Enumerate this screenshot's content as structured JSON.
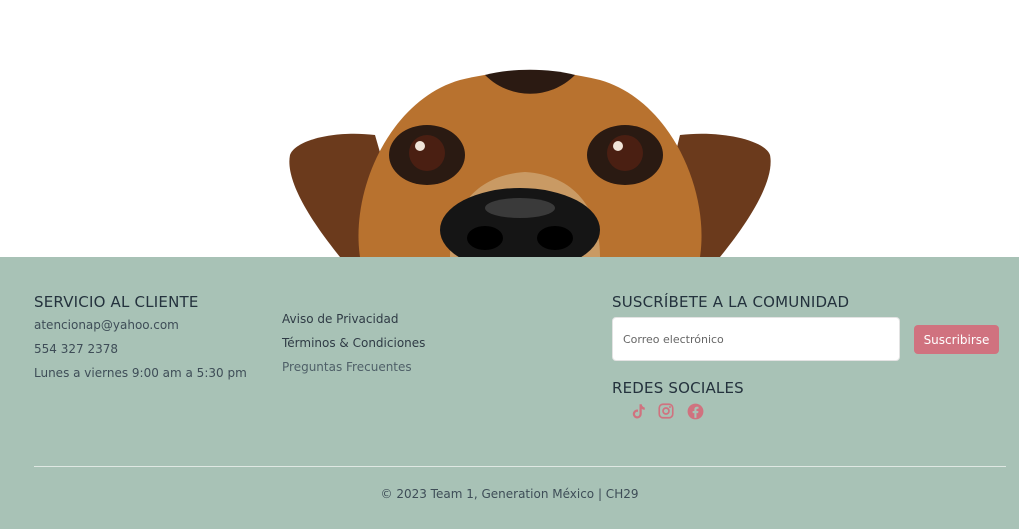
{
  "hero": {
    "image_alt": "Perro asomándose"
  },
  "customer_service": {
    "title": "SERVICIO AL CLIENTE",
    "email": "atencionap@yahoo.com",
    "phone": "554 327 2378",
    "hours": "Lunes a viernes 9:00 am a 5:30 pm"
  },
  "links": {
    "privacy": "Aviso de Privacidad",
    "terms": "Términos & Condiciones",
    "faq": "Preguntas Frecuentes"
  },
  "subscribe": {
    "title": "SUSCRÍBETE A LA COMUNIDAD",
    "placeholder": "Correo electrónico",
    "button_label": "Suscribirse"
  },
  "social": {
    "title": "REDES SOCIALES",
    "icons": [
      "tiktok-icon",
      "instagram-icon",
      "facebook-icon"
    ]
  },
  "footer": {
    "copyright": "© 2023 Team 1, Generation México | CH29"
  },
  "colors": {
    "footer_bg": "#a8c2b6",
    "accent": "#d0727f",
    "text": "#24323d"
  }
}
